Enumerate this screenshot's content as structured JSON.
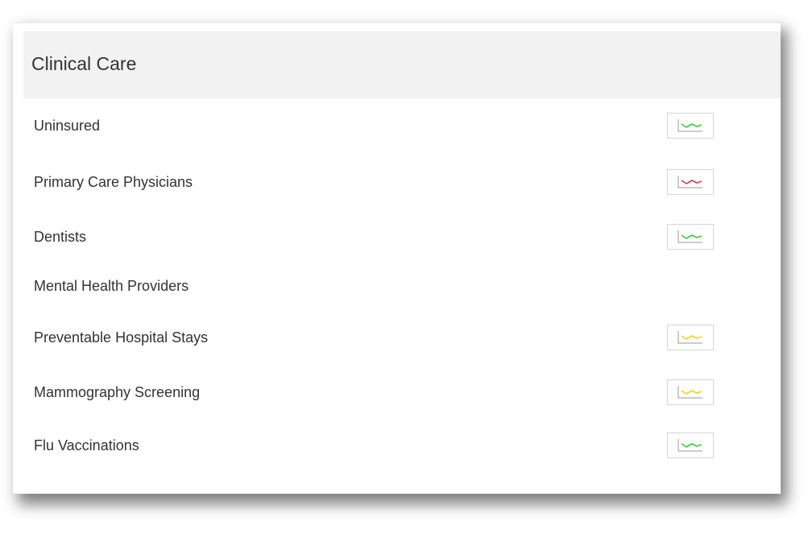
{
  "section": {
    "title": "Clinical Care"
  },
  "rows": [
    {
      "label": "Uninsured",
      "trend": {
        "status": "green",
        "color": "#3cc83c",
        "icon": "trend-line-icon"
      }
    },
    {
      "label": "Primary Care Physicians",
      "trend": {
        "status": "red",
        "color": "#e03a4e",
        "icon": "trend-line-icon"
      }
    },
    {
      "label": "Dentists",
      "trend": {
        "status": "green",
        "color": "#3cc83c",
        "icon": "trend-line-icon"
      }
    },
    {
      "label": "Mental Health Providers",
      "trend": null
    },
    {
      "label": "Preventable Hospital Stays",
      "trend": {
        "status": "yellow",
        "color": "#f0d020",
        "icon": "trend-line-icon"
      }
    },
    {
      "label": "Mammography Screening",
      "trend": {
        "status": "yellow",
        "color": "#f0d020",
        "icon": "trend-line-icon"
      }
    },
    {
      "label": "Flu Vaccinations",
      "trend": {
        "status": "green",
        "color": "#3cc83c",
        "icon": "trend-line-icon"
      }
    }
  ]
}
